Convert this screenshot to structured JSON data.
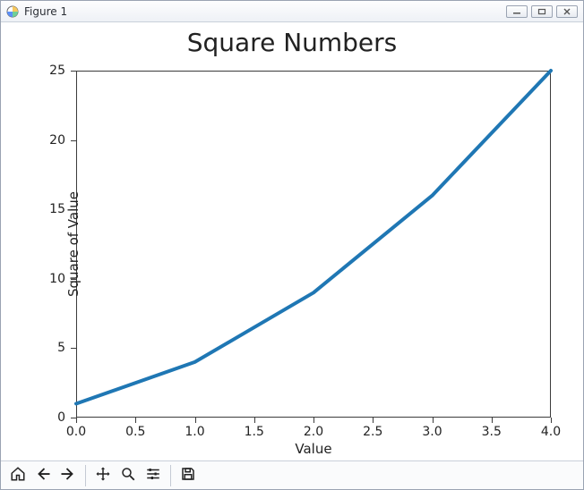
{
  "window": {
    "title": "Figure 1"
  },
  "chart_data": {
    "type": "line",
    "title": "Square Numbers",
    "xlabel": "Value",
    "ylabel": "Square of Value",
    "xlim": [
      0.0,
      4.0
    ],
    "ylim": [
      0,
      25
    ],
    "xticks": [
      "0.0",
      "0.5",
      "1.0",
      "1.5",
      "2.0",
      "2.5",
      "3.0",
      "3.5",
      "4.0"
    ],
    "yticks": [
      "0",
      "5",
      "10",
      "15",
      "20",
      "25"
    ],
    "x": [
      0,
      1,
      2,
      3,
      4
    ],
    "values": [
      1,
      4,
      9,
      16,
      25
    ],
    "line_color": "#1f77b4"
  },
  "toolbar": {
    "home": "Home",
    "back": "Back",
    "forward": "Forward",
    "pan": "Pan",
    "zoom": "Zoom",
    "configure": "Configure subplots",
    "save": "Save"
  }
}
